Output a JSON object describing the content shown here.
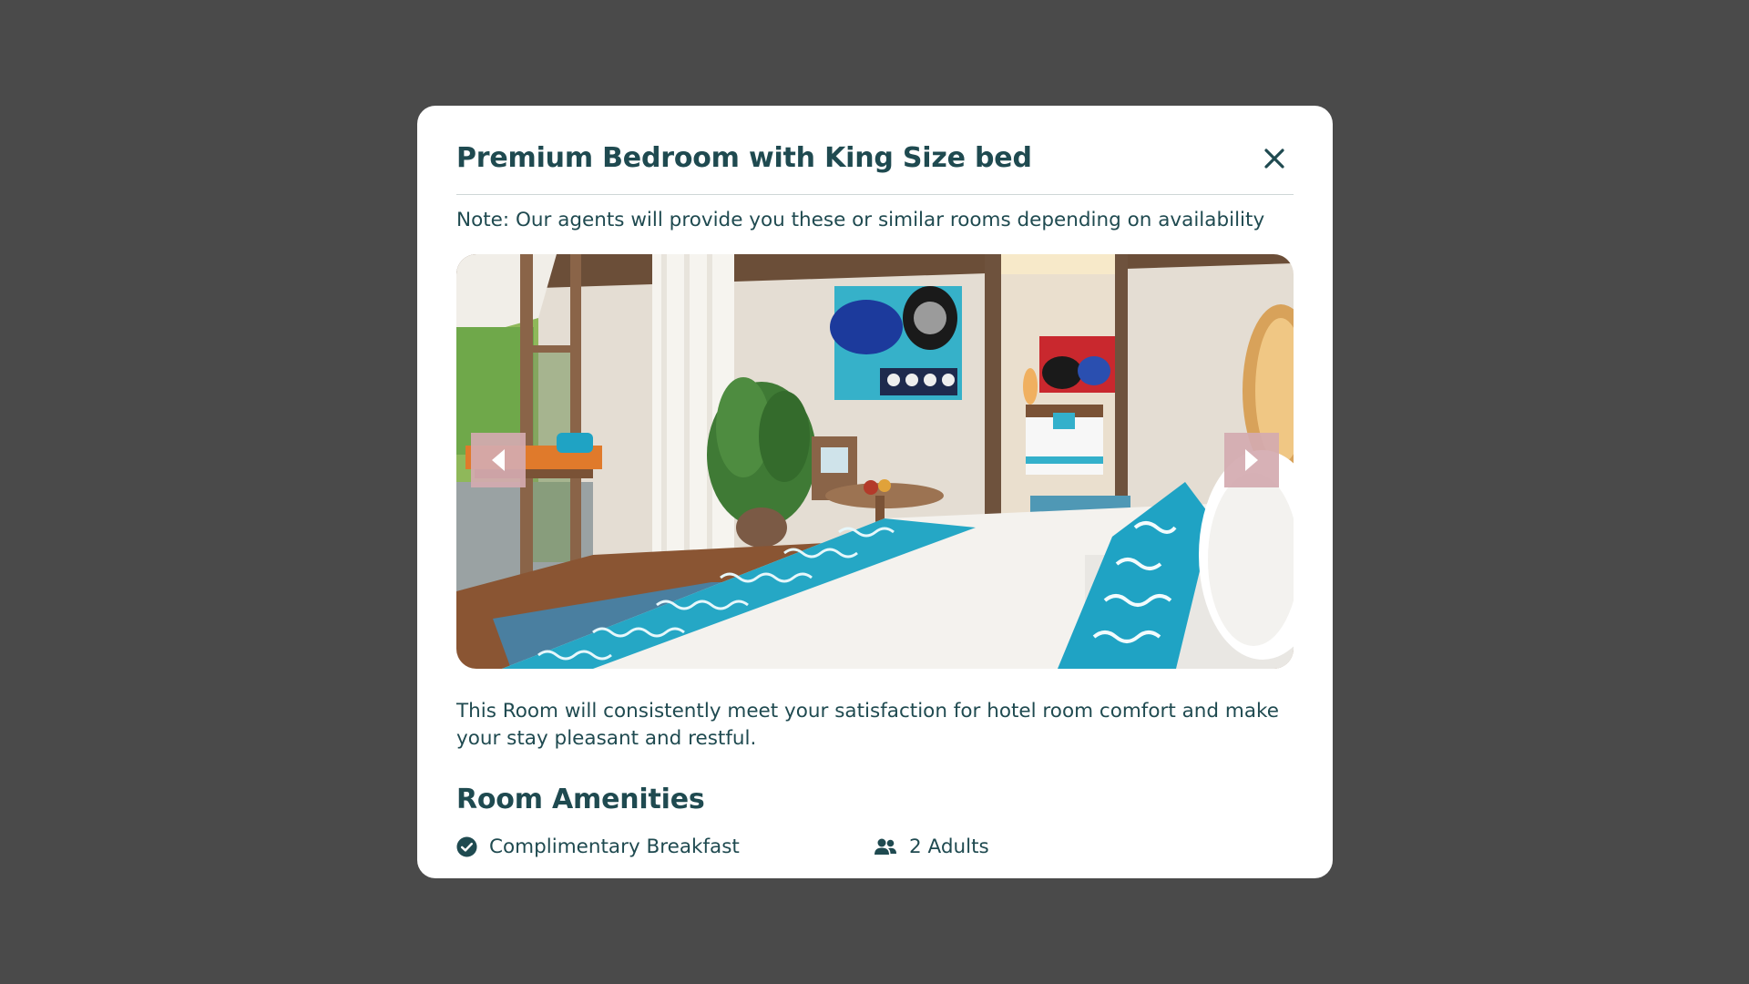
{
  "modal": {
    "title": "Premium Bedroom with King Size bed",
    "note": "Note: Our agents will provide you these or similar rooms depending on availability",
    "description": "This Room will consistently meet your satisfaction for hotel room comfort and make your stay pleasant and restful.",
    "amenities_heading": "Room Amenities",
    "amenities": [
      {
        "label": "Complimentary Breakfast",
        "icon": "check-circle-icon"
      },
      {
        "label": "2 Adults",
        "icon": "users-icon"
      }
    ]
  },
  "gallery": {
    "image_alt": "Hotel bedroom with king size bed, turquoise pillows, plant and artwork"
  },
  "colors": {
    "overlay": "#4a4a4a",
    "primary_text": "#1f4a50",
    "nav_button": "#d4aab0",
    "accent_turquoise": "#1fa3c4"
  }
}
